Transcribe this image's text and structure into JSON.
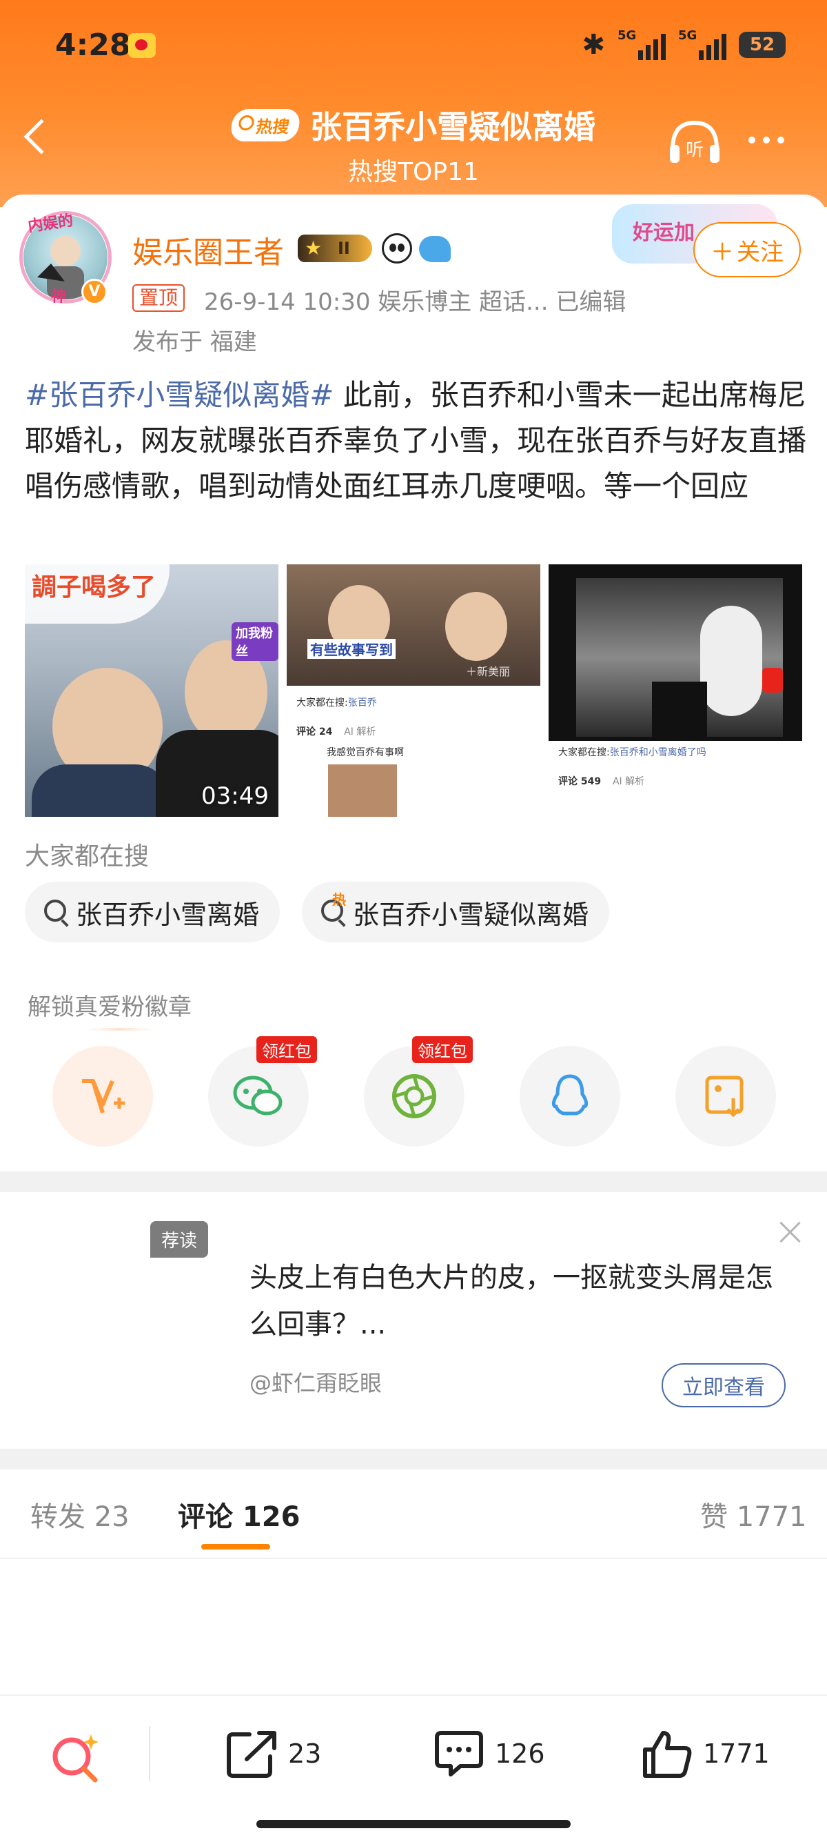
{
  "status_bar": {
    "time": "4:28",
    "network_1": "5G",
    "network_2": "5G",
    "battery": "52"
  },
  "header": {
    "hot_badge": "热搜",
    "title": "张百乔小雪疑似离婚",
    "subtitle": "热搜TOP11",
    "listen_label": "听"
  },
  "post": {
    "author": {
      "name": "娱乐圈王者",
      "avatar_text_top": "内娱的",
      "avatar_text_bottom": "神",
      "level_badge": "II"
    },
    "pinned_label": "置顶",
    "meta": "26-9-14 10:30  娱乐博主 超话...  已编辑",
    "location": "发布于 福建",
    "promo_label": "好运加",
    "follow_label": "关注",
    "hashtag": "#张百乔小雪疑似离婚#",
    "body": " 此前，张百乔和小雪未一起出席梅尼耶婚礼，网友就曝张百乔辜负了小雪，现在张百乔与好友直播唱伤感情歌，唱到动情处面红耳赤几度哽咽。等一个回应",
    "images": [
      {
        "overlay_text": "調子喝多了",
        "side_tag": "加我粉丝",
        "duration": "03:49"
      },
      {
        "subtitle": "有些故事写到",
        "watermark": "＋新美丽",
        "search_prefix": "大家都在搜:",
        "search_term": "张百乔",
        "comment_label": "评论 24",
        "ai_label": "AI 解析",
        "comment_text": "我感觉百乔有事啊"
      },
      {
        "search_prefix": "大家都在搜:",
        "search_term": "张百乔和小雪离婚了吗",
        "comment_label": "评论 549",
        "ai_label": "AI 解析"
      }
    ]
  },
  "everyone_searching": {
    "label": "大家都在搜",
    "chips": [
      "张百乔小雪离婚",
      "张百乔小雪疑似离婚"
    ],
    "hot_mark": "热"
  },
  "share": {
    "label": "解锁真爱粉徽章",
    "items": [
      {
        "name": "vplus",
        "icon": "vplus-icon"
      },
      {
        "name": "wechat",
        "icon": "wechat-icon",
        "badge": "领红包"
      },
      {
        "name": "moments",
        "icon": "moments-icon",
        "badge": "领红包"
      },
      {
        "name": "qq",
        "icon": "qq-icon"
      },
      {
        "name": "save-image",
        "icon": "save-image-icon"
      }
    ]
  },
  "recommend": {
    "tag": "荐读",
    "title": "头皮上有白色大片的皮，一抠就变头屑是怎么回事？...",
    "author": "@虾仁甭眨眼",
    "button": "立即查看"
  },
  "tabs": {
    "repost": "转发 23",
    "comment": "评论 126",
    "like": "赞 1771"
  },
  "bottom_bar": {
    "repost_count": "23",
    "comment_count": "126",
    "like_count": "1771"
  },
  "colors": {
    "brand_orange": "#ff8200",
    "hashtag_blue": "#4b6aa8",
    "username_orange": "#f5720b"
  }
}
